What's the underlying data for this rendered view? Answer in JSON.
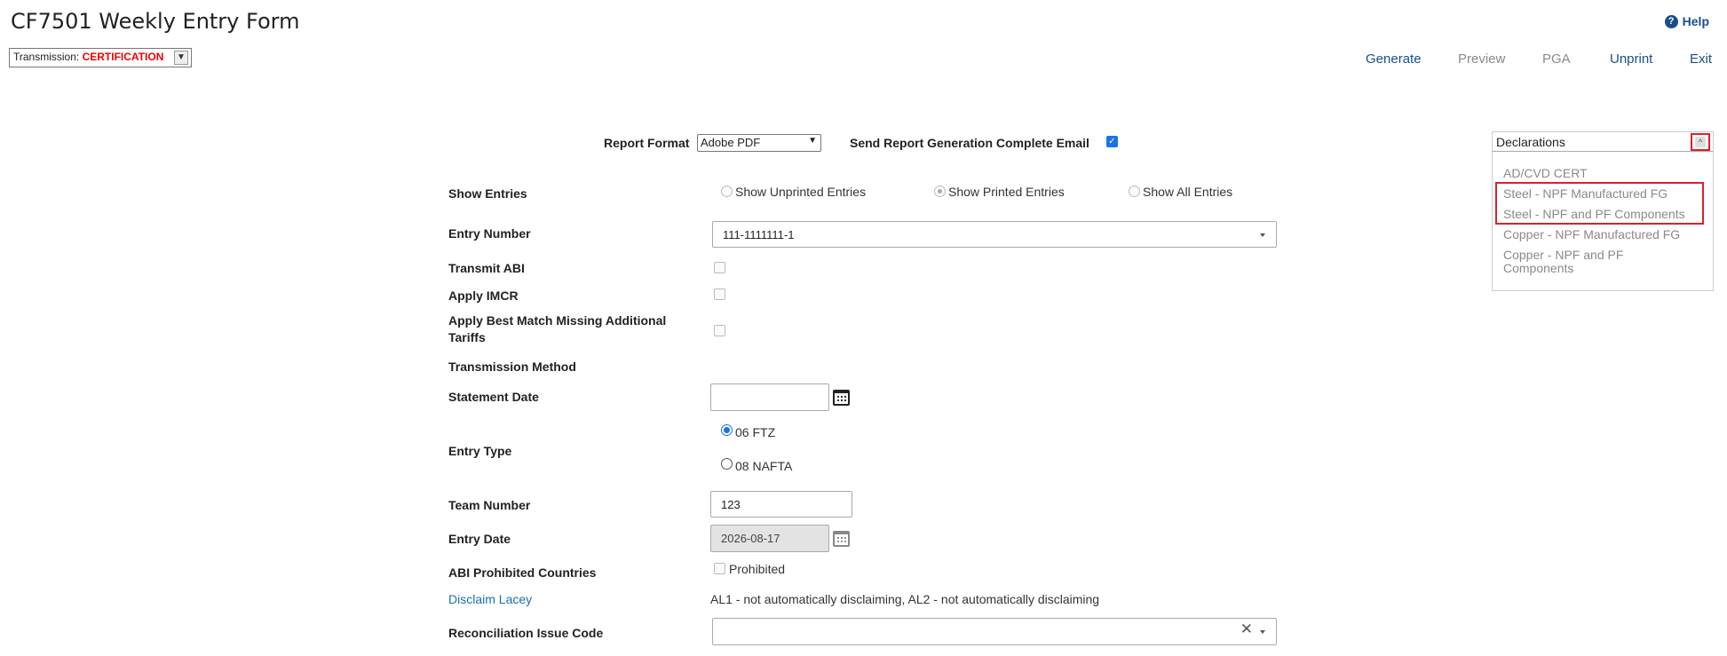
{
  "page": {
    "title": "CF7501 Weekly Entry Form",
    "transmission_label": "Transmission:",
    "transmission_value": "CERTIFICATION",
    "help_label": "Help"
  },
  "toolbar": {
    "generate": "Generate",
    "preview": "Preview",
    "pga": "PGA",
    "unprint": "Unprint",
    "exit": "Exit"
  },
  "report": {
    "format_label": "Report Format",
    "format_value": "Adobe PDF",
    "email_label": "Send Report Generation Complete Email",
    "email_checked": true
  },
  "form": {
    "show_entries_label": "Show Entries",
    "show_entries_options": [
      "Show Unprinted Entries",
      "Show Printed Entries",
      "Show All Entries"
    ],
    "show_entries_selected": "Show Printed Entries",
    "entry_number_label": "Entry Number",
    "entry_number_value": "111-1111111-1",
    "transmit_abi_label": "Transmit ABI",
    "apply_imcr_label": "Apply IMCR",
    "apply_best_match_label": "Apply Best Match Missing Additional Tariffs",
    "transmission_method_label": "Transmission Method",
    "statement_date_label": "Statement Date",
    "statement_date_value": "",
    "entry_type_label": "Entry Type",
    "entry_type_options": [
      "06 FTZ",
      "08 NAFTA"
    ],
    "entry_type_selected": "06 FTZ",
    "team_number_label": "Team Number",
    "team_number_value": "123",
    "entry_date_label": "Entry Date",
    "entry_date_value": "2026-08-17",
    "abi_prohibited_label": "ABI Prohibited Countries",
    "prohibited_checkbox_label": "Prohibited",
    "disclaim_lacey_link": "Disclaim Lacey",
    "disclaim_lacey_text": "AL1 - not automatically disclaiming, AL2 - not automatically disclaiming",
    "reconciliation_label": "Reconciliation Issue Code",
    "reconciliation_value": ""
  },
  "declarations": {
    "header": "Declarations",
    "items": [
      "AD/CVD CERT",
      "Steel - NPF Manufactured FG",
      "Steel - NPF and PF Components",
      "Copper - NPF Manufactured FG",
      "Copper - NPF and PF Components"
    ]
  },
  "colors": {
    "link_blue": "#1a4e8a",
    "alert_red": "#e01f2b",
    "check_blue": "#1a73e8"
  }
}
